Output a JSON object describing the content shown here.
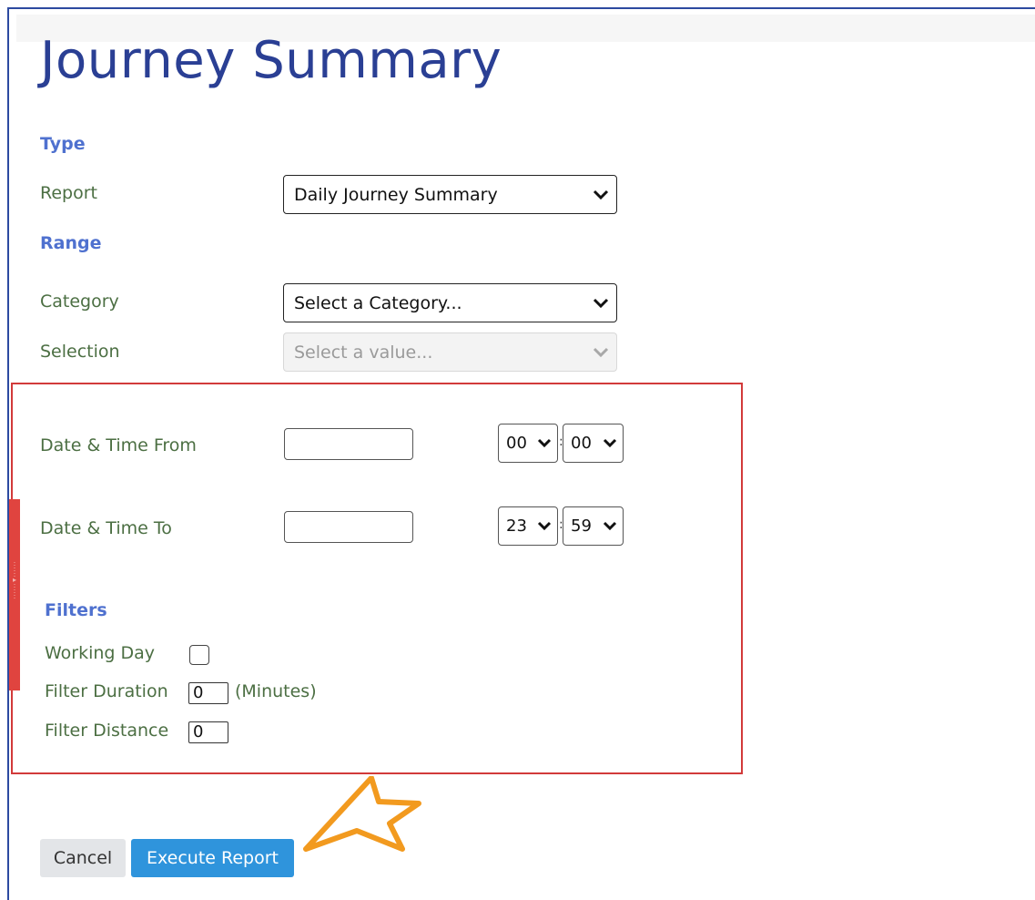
{
  "page": {
    "title": "Journey Summary"
  },
  "type_section": {
    "heading": "Type",
    "report_label": "Report",
    "report_value": "Daily Journey Summary"
  },
  "range_section": {
    "heading": "Range",
    "category_label": "Category",
    "category_value": "Select a Category...",
    "selection_label": "Selection",
    "selection_value": "Select a value..."
  },
  "date_time": {
    "from_label": "Date & Time From",
    "from_date": "",
    "from_hour": "00",
    "from_minute": "00",
    "to_label": "Date & Time To",
    "to_date": "",
    "to_hour": "23",
    "to_minute": "59",
    "separator": ":"
  },
  "filters": {
    "heading": "Filters",
    "working_day_label": "Working Day",
    "working_day_checked": false,
    "duration_label": "Filter Duration",
    "duration_value": "0",
    "duration_unit": "(Minutes)",
    "distance_label": "Filter Distance",
    "distance_value": "0"
  },
  "actions": {
    "cancel_label": "Cancel",
    "execute_label": "Execute Report"
  },
  "colors": {
    "title": "#2a3f94",
    "section_heading": "#4f71cf",
    "field_label": "#4c6f43",
    "highlight_border": "#d23a3a",
    "annotation_arrow": "#f29a1f",
    "execute_button": "#2f94dc",
    "cancel_button": "#e3e5e8"
  },
  "icons": {
    "dropdown": "chevron-down-icon",
    "annotation": "arrow-annotation-icon"
  }
}
